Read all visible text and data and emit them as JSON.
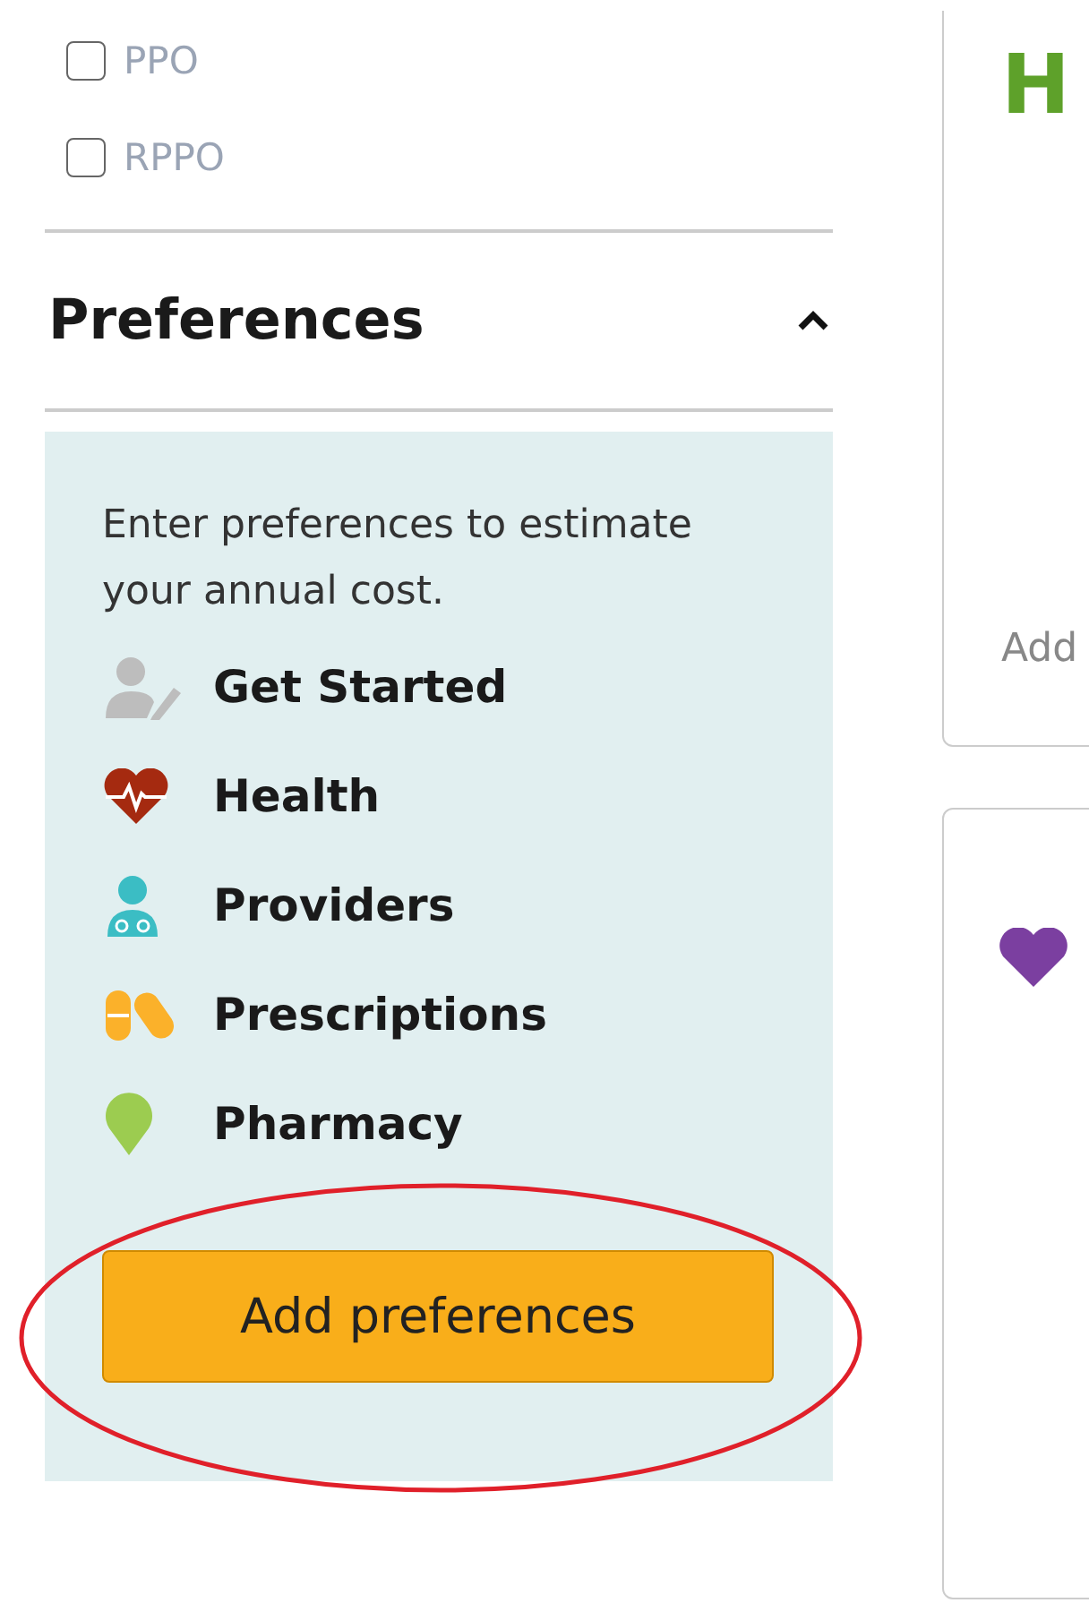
{
  "plan_types": [
    {
      "label": "PPO",
      "checked": false
    },
    {
      "label": "RPPO",
      "checked": false
    }
  ],
  "preferences": {
    "title": "Preferences",
    "expanded": true,
    "intro": "Enter preferences to estimate your annual cost.",
    "steps": [
      {
        "kind": "person",
        "label": "Get Started"
      },
      {
        "kind": "heart",
        "label": "Health"
      },
      {
        "kind": "doctor",
        "label": "Providers"
      },
      {
        "kind": "pills",
        "label": "Prescriptions"
      },
      {
        "kind": "pin",
        "label": "Pharmacy"
      }
    ],
    "button": "Add preferences"
  },
  "plan_cards": [
    {
      "kind": "plain",
      "title": "H",
      "footer": "Add"
    },
    {
      "kind": "heart"
    }
  ]
}
